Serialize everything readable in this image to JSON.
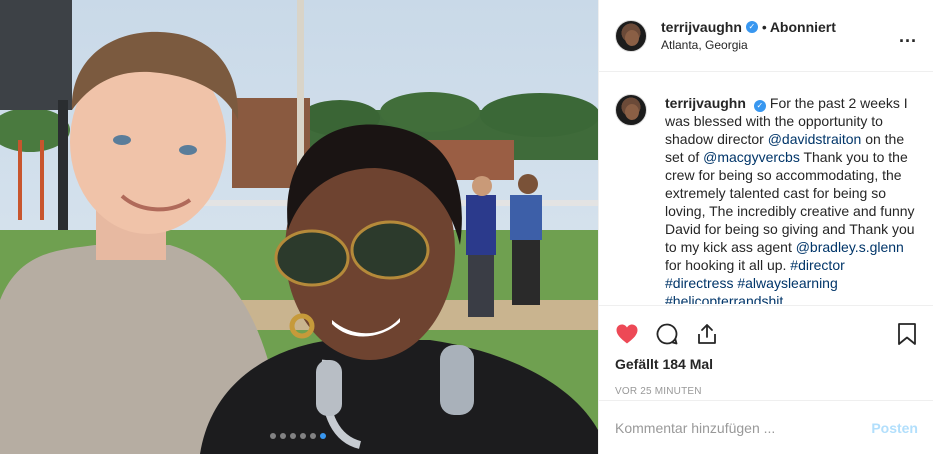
{
  "photo": {
    "alt_description_icon": "photo",
    "carousel_dots": 6,
    "carousel_active_index": 5
  },
  "header": {
    "username": "terrijvaughn",
    "verified_icon": "verified-badge-icon",
    "separator": "•",
    "follow_status": "Abonniert",
    "location": "Atlanta, Georgia",
    "more_icon": "more-options-icon",
    "more_label": "..."
  },
  "caption": {
    "username": "terrijvaughn",
    "parts": [
      "For the past 2 weeks I was blessed with the opportunity to shadow director ",
      "@davidstraiton",
      " on the set of ",
      "@macgyvercbs",
      " Thank you to the crew for being so accommodating, the extremely talented cast for being so loving, The incredibly creative and funny David for being so giving and Thank you to my kick ass agent ",
      "@bradley.s.glenn",
      " for hooking it all up. ",
      "#director",
      " ",
      "#directress",
      " ",
      "#alwayslearning",
      " ",
      "#helicopterrandshit"
    ]
  },
  "actions": {
    "like_icon": "heart-icon",
    "comment_icon": "comment-icon",
    "share_icon": "share-icon",
    "save_icon": "bookmark-icon",
    "likes_text": "Gefällt 184 Mal",
    "timestamp": "VOR 25 MINUTEN"
  },
  "comment": {
    "placeholder": "Kommentar hinzufügen ...",
    "post_label": "Posten"
  },
  "colors": {
    "like_red": "#ed4956",
    "link_blue": "#003569",
    "verified_blue": "#3897f0",
    "post_disabled": "#b2dffc"
  }
}
